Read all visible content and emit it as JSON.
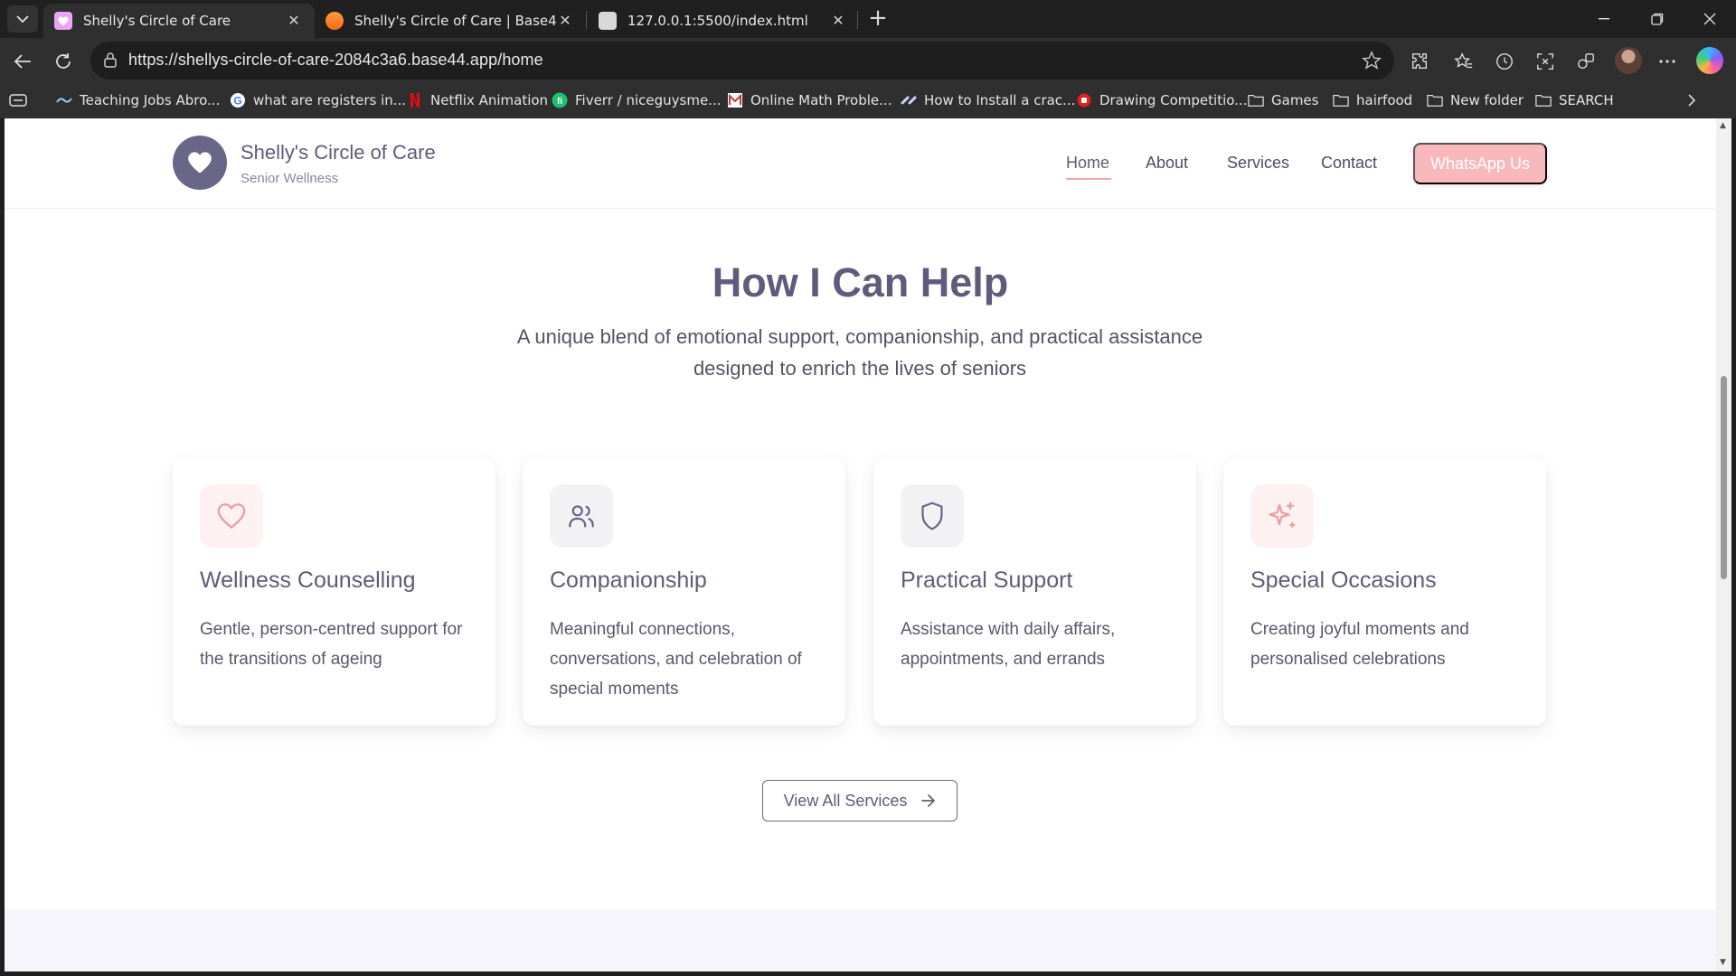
{
  "browser": {
    "tabs": [
      {
        "title": "Shelly's Circle of Care",
        "active": true
      },
      {
        "title": "Shelly's Circle of Care | Base44",
        "active": false
      },
      {
        "title": "127.0.0.1:5500/index.html",
        "active": false
      }
    ],
    "url": "https://shellys-circle-of-care-2084c3a6.base44.app/home",
    "bookmarks": [
      {
        "label": "Teaching Jobs Abro...",
        "icon": "wave-icon"
      },
      {
        "label": "what are registers in...",
        "icon": "google-icon"
      },
      {
        "label": "Netflix Animation",
        "icon": "netflix-icon"
      },
      {
        "label": "Fiverr / niceguysme...",
        "icon": "fiverr-icon"
      },
      {
        "label": "Online Math Proble...",
        "icon": "math-icon"
      },
      {
        "label": "How to Install a crac...",
        "icon": "link-icon"
      },
      {
        "label": "Drawing Competitio...",
        "icon": "red-circle-icon"
      },
      {
        "label": "Games",
        "icon": "folder-icon"
      },
      {
        "label": "hairfood",
        "icon": "folder-icon"
      },
      {
        "label": "New folder",
        "icon": "folder-icon"
      },
      {
        "label": "SEARCH",
        "icon": "folder-icon"
      }
    ]
  },
  "site": {
    "brand": {
      "name": "Shelly's Circle of Care",
      "subtitle": "Senior Wellness"
    },
    "nav": {
      "home": "Home",
      "about": "About",
      "services": "Services",
      "contact": "Contact",
      "cta": "WhatsApp Us"
    },
    "section": {
      "title": "How I Can Help",
      "subtitle_line1": "A unique blend of emotional support, companionship, and practical assistance",
      "subtitle_line2": "designed to enrich the lives of seniors"
    },
    "cards": [
      {
        "title": "Wellness Counselling",
        "description": "Gentle, person-centred support for the transitions of ageing",
        "icon": "heart-icon"
      },
      {
        "title": "Companionship",
        "description": "Meaningful connections, conversations, and celebration of special moments",
        "icon": "users-icon"
      },
      {
        "title": "Practical Support",
        "description": "Assistance with daily affairs, appointments, and errands",
        "icon": "shield-icon"
      },
      {
        "title": "Special Occasions",
        "description": "Creating joyful moments and personalised celebrations",
        "icon": "sparkles-icon"
      }
    ],
    "view_all": "View All Services"
  },
  "colors": {
    "brand_purple": "#6a6688",
    "accent_pink": "#f8b8bc",
    "heading": "#5f5b7a"
  }
}
